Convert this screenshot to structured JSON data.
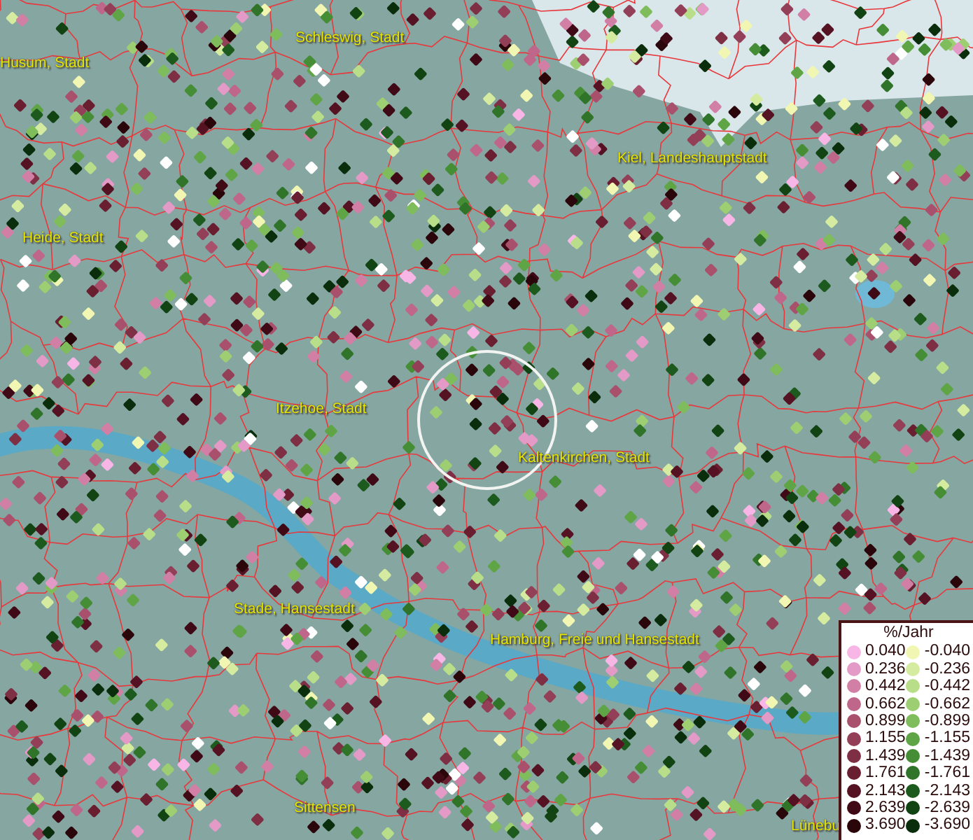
{
  "map": {
    "labels": [
      {
        "text": "Husum, Stadt"
      },
      {
        "text": "Schleswig, Stadt"
      },
      {
        "text": "Kiel, Landeshauptstadt"
      },
      {
        "text": "Heide, Stadt"
      },
      {
        "text": "Itzehoe, Stadt"
      },
      {
        "text": "Kaltenkirchen, Stadt"
      },
      {
        "text": "Stade, Hansestadt"
      },
      {
        "text": "Hamburg, Freie und Hansestadt"
      },
      {
        "text": "Sittensen"
      },
      {
        "text": "Lünebu"
      }
    ]
  },
  "legend": {
    "title": "%/Jahr",
    "positive": [
      {
        "label": "0.040",
        "color": "#f7b6e6"
      },
      {
        "label": "0.236",
        "color": "#e39ac6"
      },
      {
        "label": "0.442",
        "color": "#d27fa6"
      },
      {
        "label": "0.662",
        "color": "#bf678a"
      },
      {
        "label": "0.899",
        "color": "#a9506d"
      },
      {
        "label": "1.155",
        "color": "#943f58"
      },
      {
        "label": "1.439",
        "color": "#7e2f44"
      },
      {
        "label": "1.761",
        "color": "#691f30"
      },
      {
        "label": "2.143",
        "color": "#551222"
      },
      {
        "label": "2.639",
        "color": "#3f0a15"
      },
      {
        "label": "3.690",
        "color": "#2a050a"
      }
    ],
    "negative": [
      {
        "label": "-0.040",
        "color": "#f1f7b2"
      },
      {
        "label": "-0.236",
        "color": "#d5eca0"
      },
      {
        "label": "-0.442",
        "color": "#b9de89"
      },
      {
        "label": "-0.662",
        "color": "#9dcf72"
      },
      {
        "label": "-0.899",
        "color": "#7fbc5b"
      },
      {
        "label": "-1.155",
        "color": "#5fa545"
      },
      {
        "label": "-1.439",
        "color": "#468e35"
      },
      {
        "label": "-1.761",
        "color": "#2f7429"
      },
      {
        "label": "-2.143",
        "color": "#1d5a1d"
      },
      {
        "label": "-2.639",
        "color": "#124313"
      },
      {
        "label": "-3.690",
        "color": "#0a2e0b"
      }
    ]
  }
}
